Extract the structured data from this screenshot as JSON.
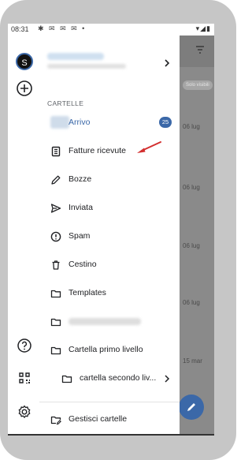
{
  "status_bar": {
    "time": "08:31",
    "notification_icons": "✱ ✉ ✉ ✉ •",
    "right_icons": "▾◢▮"
  },
  "account": {
    "avatar_letter": "S"
  },
  "drawer": {
    "section_title": "CARTELLE",
    "inbox": {
      "label": "Arrivo",
      "count": "25"
    },
    "items": [
      {
        "label": "Fatture ricevute",
        "icon": "invoice-icon"
      },
      {
        "label": "Bozze",
        "icon": "pencil-icon"
      },
      {
        "label": "Inviata",
        "icon": "send-icon"
      },
      {
        "label": "Spam",
        "icon": "spam-icon"
      },
      {
        "label": "Cestino",
        "icon": "trash-icon"
      },
      {
        "label": "Templates",
        "icon": "folder-icon"
      }
    ],
    "folder_primo": {
      "label": "Cartella primo livello"
    },
    "folder_secondo": {
      "label": "cartella secondo liv..."
    },
    "manage": {
      "label": "Gestisci cartelle"
    }
  },
  "background_list": {
    "chip": "Solo visibili",
    "dates": [
      "06 lug",
      "06 lug",
      "06 lug",
      "06 lug",
      "15 mar"
    ]
  },
  "colors": {
    "accent": "#3b68a8",
    "annotation_arrow": "#d32f2f"
  }
}
